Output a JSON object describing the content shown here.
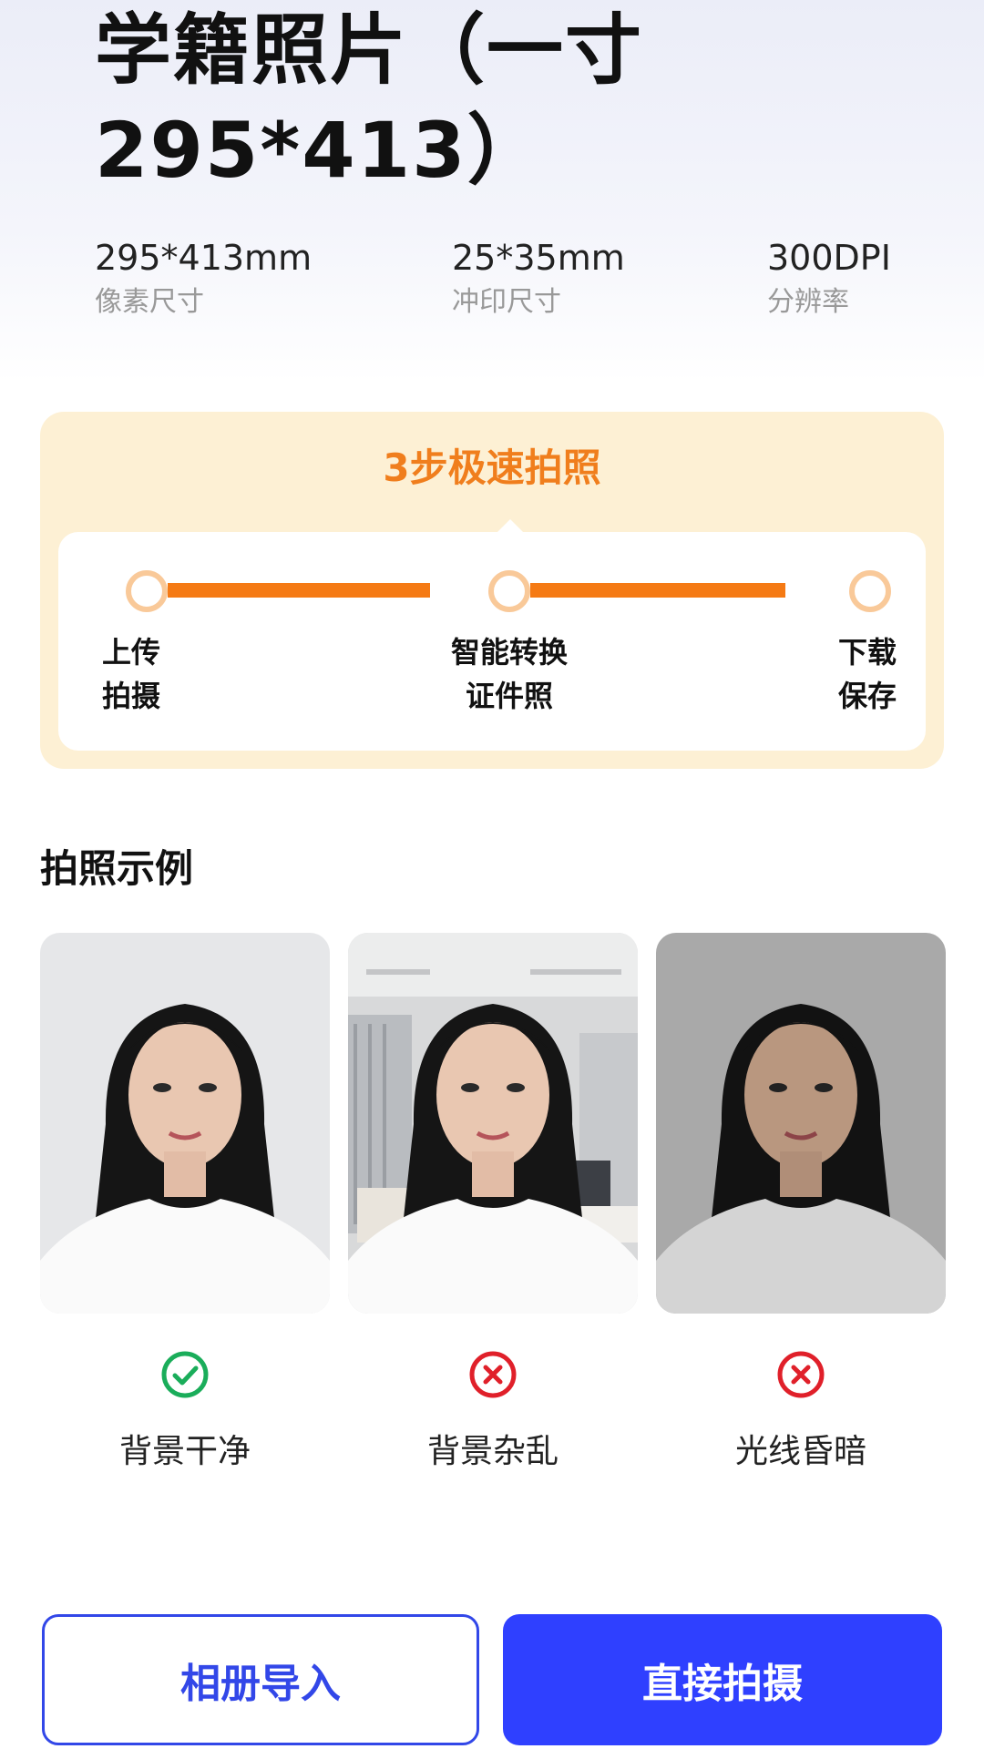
{
  "header": {
    "title_line1": "学籍照片（一寸",
    "title_line2": "295*413）"
  },
  "specs": [
    {
      "value": "295*413mm",
      "label": "像素尺寸"
    },
    {
      "value": "25*35mm",
      "label": "冲印尺寸"
    },
    {
      "value": "300DPI",
      "label": "分辨率"
    }
  ],
  "steps": {
    "title": "3步极速拍照",
    "items": [
      {
        "line1": "上传",
        "line2": "拍摄"
      },
      {
        "line1": "智能转换",
        "line2": "证件照"
      },
      {
        "line1": "下载",
        "line2": "保存"
      }
    ]
  },
  "examples": {
    "title": "拍照示例",
    "items": [
      {
        "caption": "背景干净",
        "status": "check-icon",
        "status_color": "#1aad5a"
      },
      {
        "caption": "背景杂乱",
        "status": "x-icon",
        "status_color": "#e0202a"
      },
      {
        "caption": "光线昏暗",
        "status": "x-icon",
        "status_color": "#e0202a"
      }
    ]
  },
  "actions": {
    "album_import": "相册导入",
    "take_photo": "直接拍摄"
  },
  "colors": {
    "accent_orange": "#f57a14",
    "primary_blue": "#2f40ff"
  }
}
